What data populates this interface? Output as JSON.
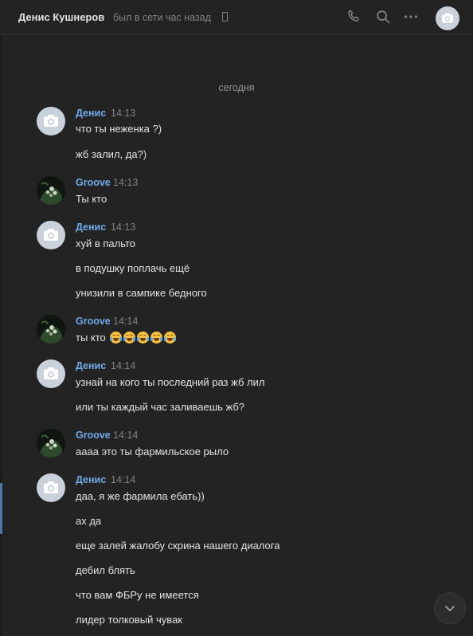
{
  "header": {
    "peer_name": "Денис Кушнеров",
    "peer_status": "был в сети час назад",
    "icons": [
      "phone-icon",
      "search-icon",
      "more-icon",
      "avatar"
    ]
  },
  "chat": {
    "date_separator": "сегодня",
    "groups": [
      {
        "author": "Денис",
        "time": "14:13",
        "avatar": "camera-placeholder",
        "lines": [
          "что ты неженка ?)",
          "жб залил, да?)"
        ]
      },
      {
        "author": "Groove",
        "time": "14:13",
        "avatar": "green-photo",
        "lines": [
          "Ты кто"
        ]
      },
      {
        "author": "Денис",
        "time": "14:13",
        "avatar": "camera-placeholder",
        "lines": [
          "хуй в пальто",
          "в подушку поплачь ещё",
          "унизили в сампике бедного"
        ]
      },
      {
        "author": "Groove",
        "time": "14:14",
        "avatar": "green-photo",
        "lines": [
          "ты кто"
        ],
        "emoji": "😂😂😂😂😂"
      },
      {
        "author": "Денис",
        "time": "14:14",
        "avatar": "camera-placeholder",
        "lines": [
          "узнай на кого ты последний раз жб лил",
          "или ты каждый час заливаешь жб?"
        ]
      },
      {
        "author": "Groove",
        "time": "14:14",
        "avatar": "green-photo",
        "lines": [
          "аааа это ты фармильское рыло"
        ]
      },
      {
        "author": "Денис",
        "time": "14:14",
        "avatar": "camera-placeholder",
        "lines": [
          "даа, я же фармила ебать))",
          "ах да",
          "еще залей жалобу скрина нашего диалога",
          "дебил блять",
          "что вам ФБРу не имеется",
          "лидер толковый чувак"
        ]
      }
    ]
  },
  "colors": {
    "background": "#232323",
    "author": "#71aaeb",
    "text": "#e1e3e6",
    "muted": "#828282",
    "accent": "#4a76a8"
  }
}
